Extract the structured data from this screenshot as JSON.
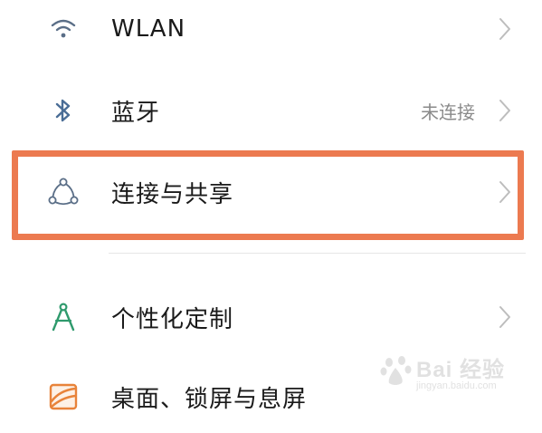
{
  "rows": [
    {
      "label": "WLAN",
      "status": "",
      "icon": "wifi-icon"
    },
    {
      "label": "蓝牙",
      "status": "未连接",
      "icon": "bluetooth-icon"
    },
    {
      "label": "连接与共享",
      "status": "",
      "icon": "connection-sharing-icon"
    },
    {
      "label": "个性化定制",
      "status": "",
      "icon": "personalization-icon"
    },
    {
      "label": "桌面、锁屏与息屏",
      "status": "",
      "icon": "wallpaper-icon"
    }
  ],
  "colors": {
    "highlight_border": "#ec7a50",
    "icon_wifi": "#5a6e87",
    "icon_bluetooth": "#4a6d96",
    "icon_personalization": "#2f9a6d",
    "icon_wallpaper": "#e8833a",
    "chevron": "#bdbdbd"
  },
  "watermark": {
    "brand": "Bai 经验",
    "sub": "jingyan.baidu.com"
  }
}
